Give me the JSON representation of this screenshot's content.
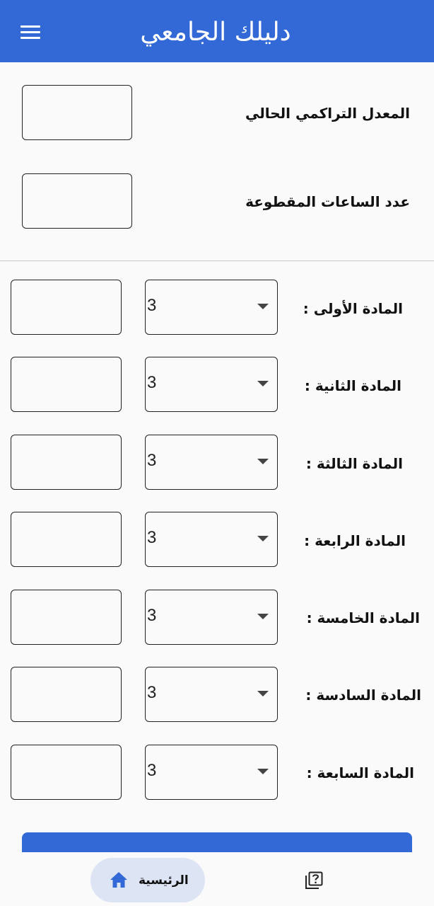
{
  "app": {
    "title": "دليلك الجامعي",
    "accent_color": "#3369d6"
  },
  "summary": {
    "gpa_label": "المعدل التراكمي الحالي",
    "gpa_value": "",
    "hours_label": "عدد الساعات المقطوعة",
    "hours_value": ""
  },
  "subjects": [
    {
      "label": "المادة الأولى :",
      "hours": "3",
      "grade": ""
    },
    {
      "label": "المادة الثانية :",
      "hours": "3",
      "grade": ""
    },
    {
      "label": "المادة الثالثة :",
      "hours": "3",
      "grade": ""
    },
    {
      "label": "المادة الرابعة :",
      "hours": "3",
      "grade": ""
    },
    {
      "label": "المادة الخامسة :",
      "hours": "3",
      "grade": ""
    },
    {
      "label": "المادة السادسة :",
      "hours": "3",
      "grade": ""
    },
    {
      "label": "المادة السابعة :",
      "hours": "3",
      "grade": ""
    }
  ],
  "bottom_nav": {
    "home_label": "الرئيسية",
    "home_icon": "home-icon",
    "guide_icon": "question-book-icon"
  }
}
